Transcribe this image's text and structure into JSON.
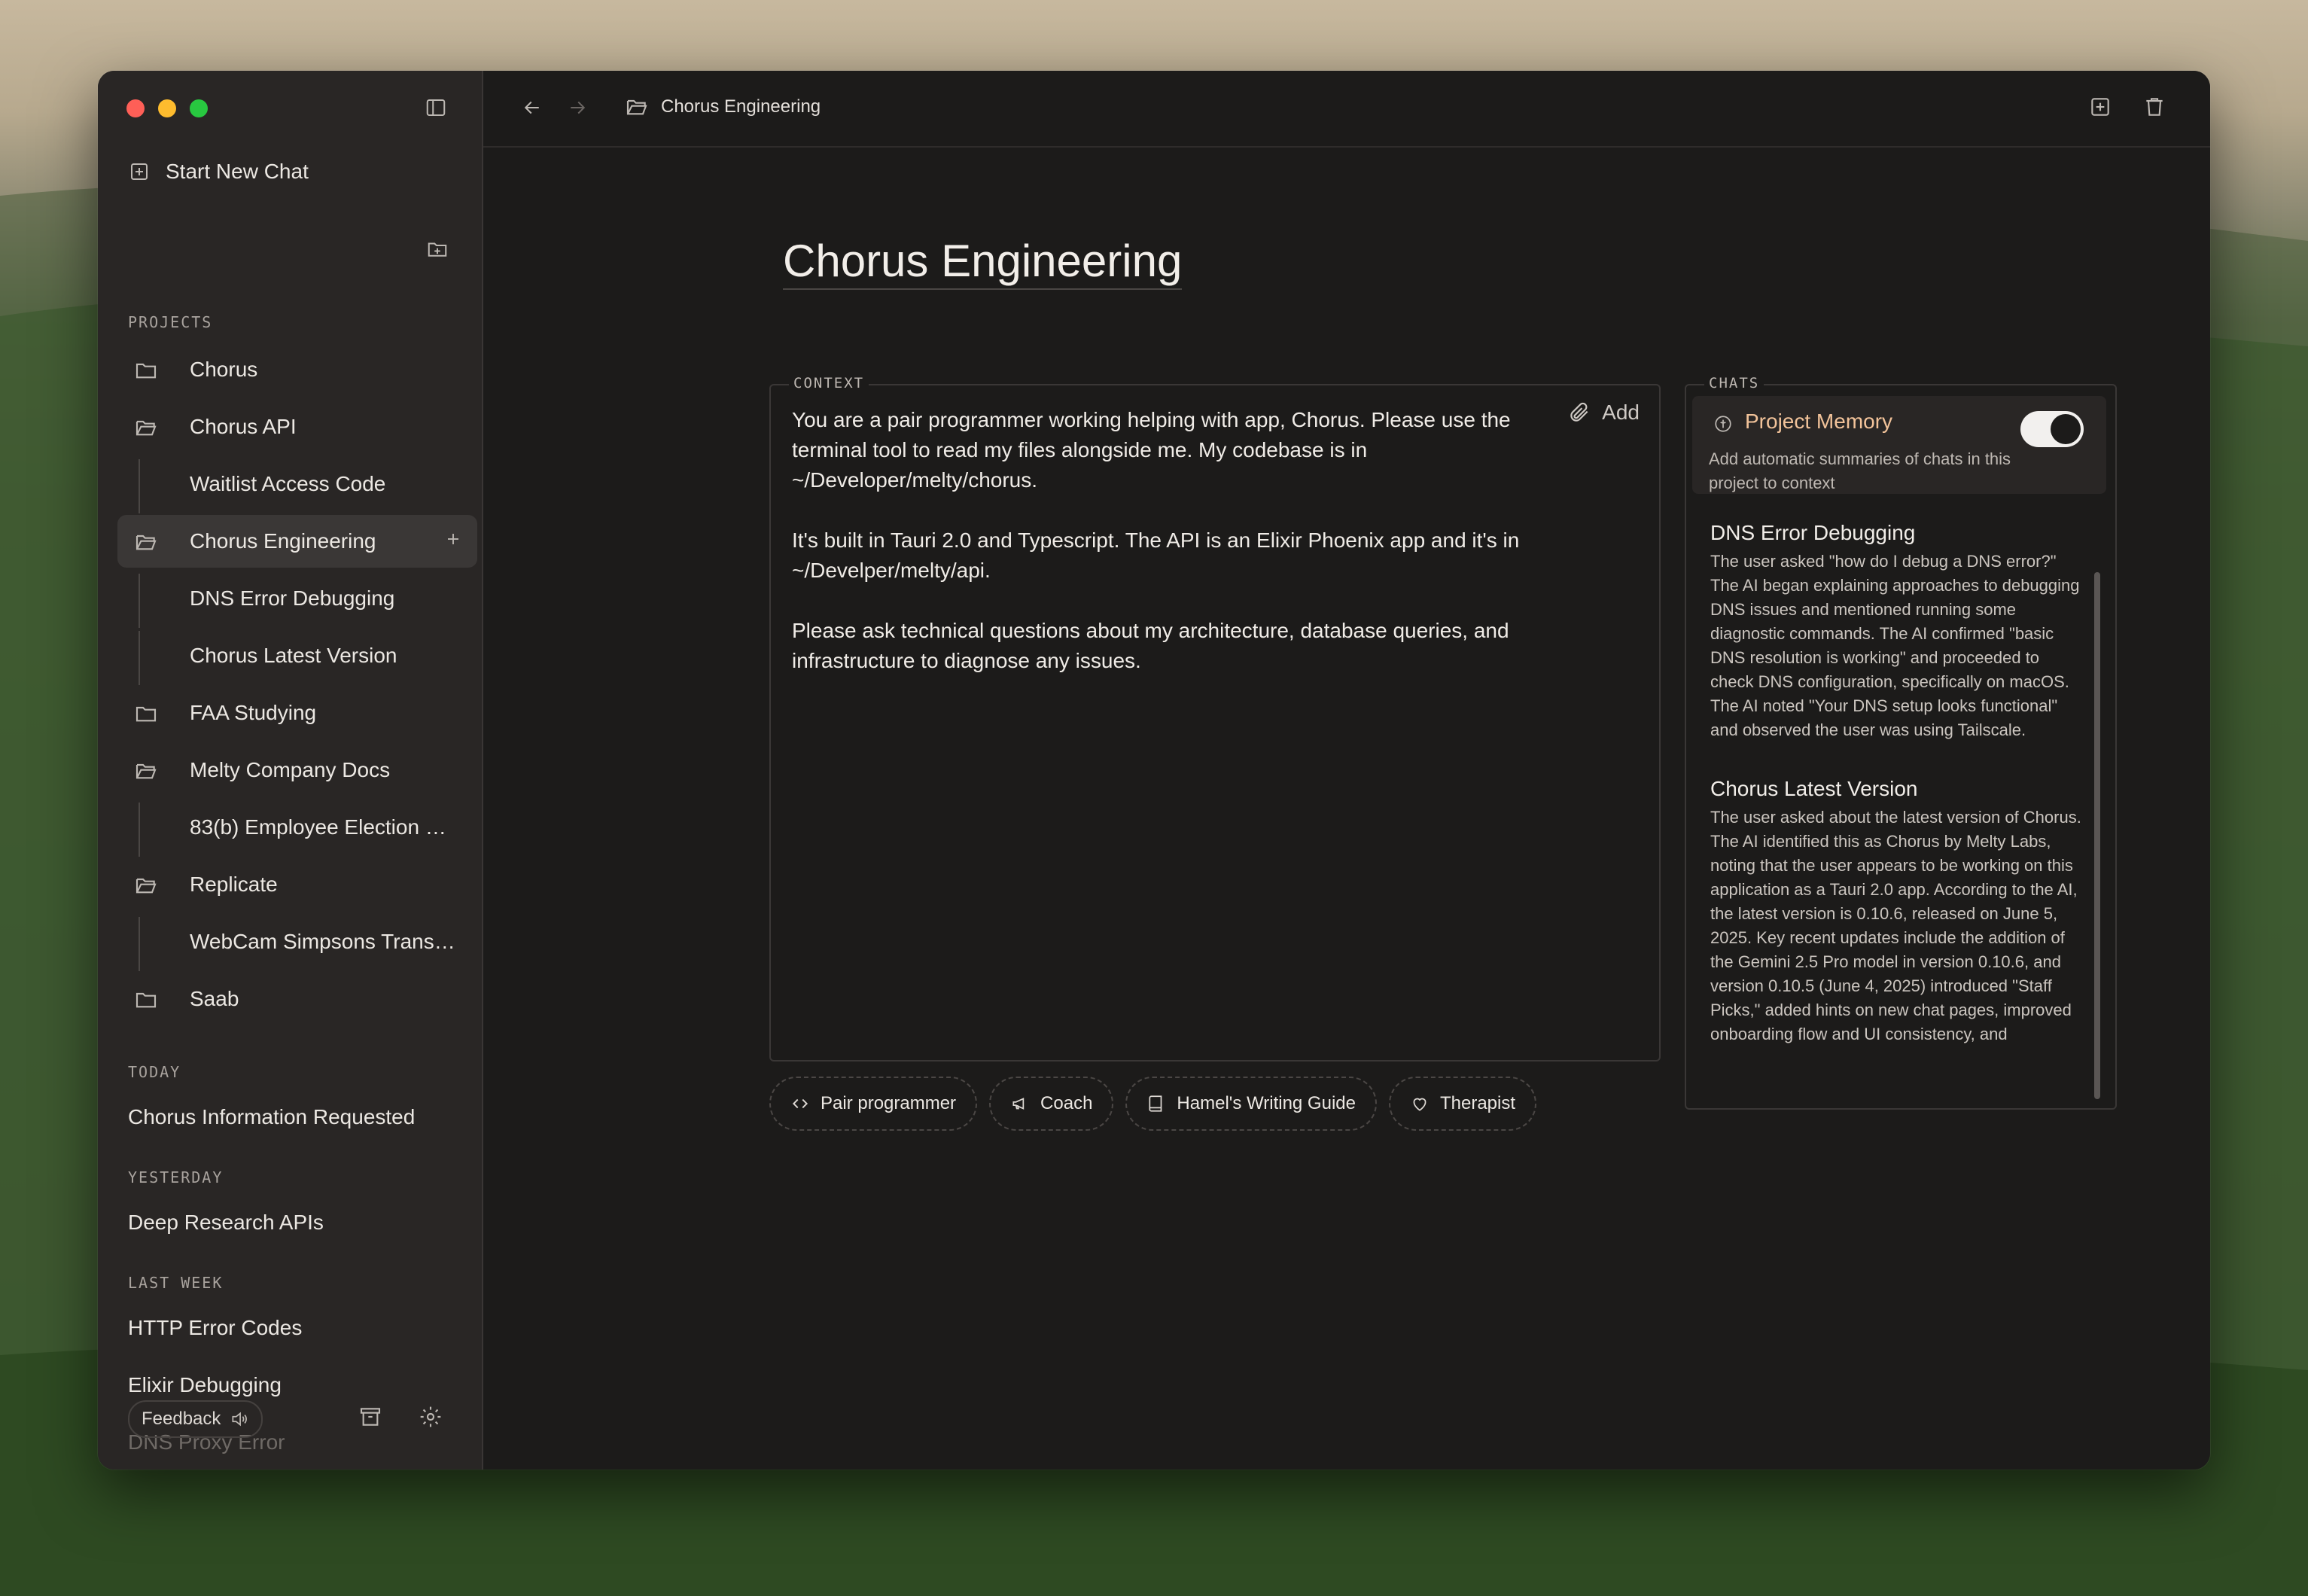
{
  "window": {
    "breadcrumb": "Chorus Engineering"
  },
  "sidebar": {
    "new_chat_label": "Start New Chat",
    "projects_title": "PROJECTS",
    "projects": [
      {
        "label": "Chorus",
        "open": false
      },
      {
        "label": "Chorus API",
        "open": true
      },
      {
        "label": "Waitlist Access Code",
        "sub": true
      },
      {
        "label": "Chorus Engineering",
        "open": true,
        "active": true
      },
      {
        "label": "DNS Error Debugging",
        "sub": true
      },
      {
        "label": "Chorus Latest Version",
        "sub": true
      },
      {
        "label": "FAA Studying",
        "open": false
      },
      {
        "label": "Melty Company Docs",
        "open": true
      },
      {
        "label": "83(b) Employee Election Ris...",
        "sub": true
      },
      {
        "label": "Replicate",
        "open": true
      },
      {
        "label": "WebCam Simpsons Transfo...",
        "sub": true
      },
      {
        "label": "Saab",
        "open": false
      }
    ],
    "groups": [
      {
        "title": "TODAY",
        "items": [
          "Chorus Information Requested"
        ]
      },
      {
        "title": "YESTERDAY",
        "items": [
          "Deep Research APIs"
        ]
      },
      {
        "title": "LAST WEEK",
        "items": [
          "HTTP Error Codes",
          "Elixir Debugging",
          "DNS Proxy Error"
        ]
      }
    ],
    "feedback_label": "Feedback"
  },
  "main": {
    "title": "Chorus Engineering",
    "context_label": "CONTEXT",
    "add_label": "Add",
    "context_text": "You are a pair programmer working helping with app, Chorus. Please use the terminal tool to read my files alongside me. My codebase is in ~/Developer/melty/chorus.\n\nIt's built in Tauri 2.0 and Typescript. The API is an Elixir Phoenix app and it's in ~/Develper/melty/api.\n\nPlease ask technical questions about my architecture, database queries, and infrastructure to diagnose any issues.",
    "presets": [
      {
        "label": "Pair programmer",
        "icon": "code-icon"
      },
      {
        "label": "Coach",
        "icon": "megaphone-icon"
      },
      {
        "label": "Hamel's Writing Guide",
        "icon": "book-icon"
      },
      {
        "label": "Therapist",
        "icon": "heart-icon"
      }
    ],
    "chats_label": "CHATS",
    "memory": {
      "title": "Project Memory",
      "description": "Add automatic summaries of chats in this project to context",
      "enabled": true
    },
    "summaries": [
      {
        "title": "DNS Error Debugging",
        "text": "The user asked \"how do I debug a DNS error?\" The AI began explaining approaches to debugging DNS issues and mentioned running some diagnostic commands. The AI confirmed \"basic DNS resolution is working\" and proceeded to check DNS configuration, specifically on macOS. The AI noted \"Your DNS setup looks functional\" and observed the user was using Tailscale."
      },
      {
        "title": "Chorus Latest Version",
        "text": "The user asked about the latest version of Chorus. The AI identified this as Chorus by Melty Labs, noting that the user appears to be working on this application as a Tauri 2.0 app. According to the AI, the latest version is 0.10.6, released on June 5, 2025. Key recent updates include the addition of the Gemini 2.5 Pro model in version 0.10.6, and version 0.10.5 (June 4, 2025) introduced \"Staff Picks,\" added hints on new chat pages, improved onboarding flow and UI consistency, and"
      }
    ]
  }
}
